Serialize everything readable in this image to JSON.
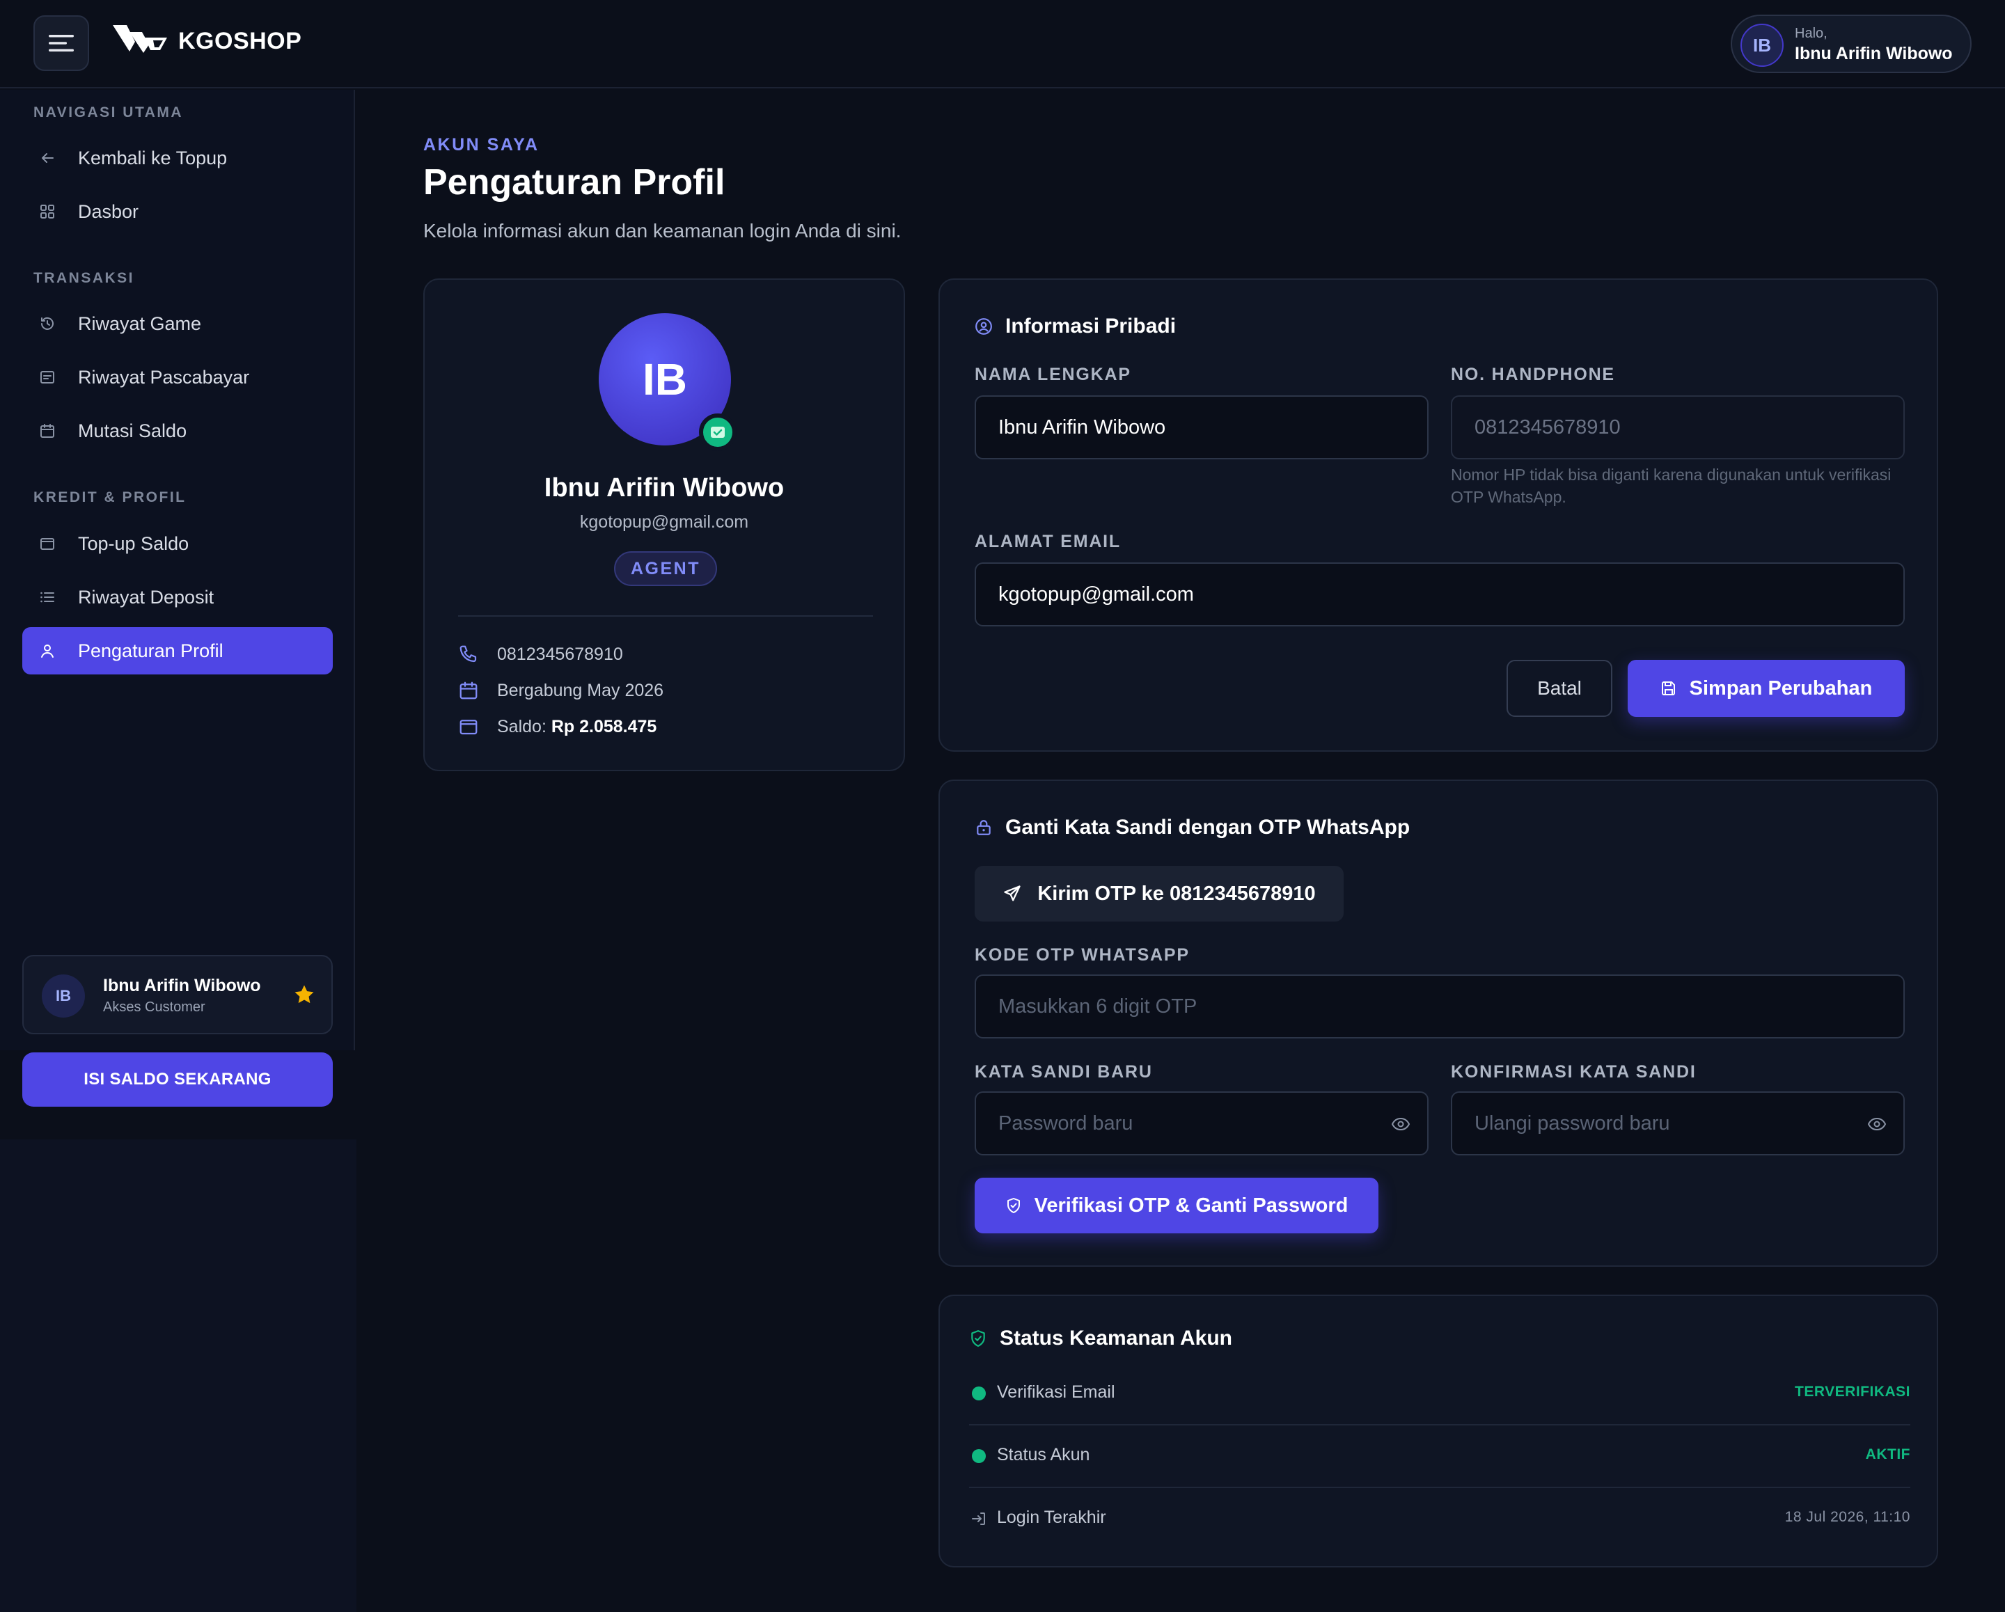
{
  "app": {
    "brand": "KGOSHOP"
  },
  "header": {
    "greeting": "Halo,",
    "user_name": "Ibnu Arifin Wibowo",
    "avatar_initials": "IB"
  },
  "sidebar": {
    "sections": [
      {
        "title": "NAVIGASI UTAMA",
        "items": [
          {
            "label": "Kembali ke Topup",
            "icon": "arrow-left-icon"
          },
          {
            "label": "Dasbor",
            "icon": "grid-icon"
          }
        ]
      },
      {
        "title": "TRANSAKSI",
        "items": [
          {
            "label": "Riwayat Game",
            "icon": "history-icon"
          },
          {
            "label": "Riwayat Pascabayar",
            "icon": "receipt-icon"
          },
          {
            "label": "Mutasi Saldo",
            "icon": "calendar-icon"
          }
        ]
      },
      {
        "title": "KREDIT & PROFIL",
        "items": [
          {
            "label": "Top-up Saldo",
            "icon": "wallet-icon"
          },
          {
            "label": "Riwayat Deposit",
            "icon": "list-icon"
          },
          {
            "label": "Pengaturan Profil",
            "icon": "user-icon",
            "active": true
          }
        ]
      }
    ],
    "user_card": {
      "initials": "IB",
      "name": "Ibnu Arifin Wibowo",
      "role": "Akses Customer"
    },
    "cta": "ISI SALDO SEKARANG"
  },
  "page": {
    "breadcrumb": "AKUN SAYA",
    "title": "Pengaturan Profil",
    "subtitle": "Kelola informasi akun dan keamanan login Anda di sini."
  },
  "profile": {
    "initials": "IB",
    "name": "Ibnu Arifin Wibowo",
    "email": "kgotopup@gmail.com",
    "role_badge": "AGENT",
    "phone": "0812345678910",
    "joined": "Bergabung May 2026",
    "balance_label": "Saldo:",
    "balance_value": "Rp 2.058.475"
  },
  "personal_info": {
    "title": "Informasi Pribadi",
    "name_label": "NAMA LENGKAP",
    "name_value": "Ibnu Arifin Wibowo",
    "phone_label": "NO. HANDPHONE",
    "phone_value": "0812345678910",
    "phone_hint": "Nomor HP tidak bisa diganti karena digunakan untuk verifikasi OTP WhatsApp.",
    "email_label": "ALAMAT EMAIL",
    "email_value": "kgotopup@gmail.com",
    "cancel": "Batal",
    "save": "Simpan Perubahan"
  },
  "password": {
    "title": "Ganti Kata Sandi dengan OTP WhatsApp",
    "send_otp": "Kirim OTP ke 0812345678910",
    "otp_label": "KODE OTP WHATSAPP",
    "otp_placeholder": "Masukkan 6 digit OTP",
    "new_label": "KATA SANDI BARU",
    "new_placeholder": "Password baru",
    "confirm_label": "KONFIRMASI KATA SANDI",
    "confirm_placeholder": "Ulangi password baru",
    "submit": "Verifikasi OTP & Ganti Password"
  },
  "security": {
    "title": "Status Keamanan Akun",
    "rows": [
      {
        "label": "Verifikasi Email",
        "value": "TERVERIFIKASI"
      },
      {
        "label": "Status Akun",
        "value": "AKTIF"
      },
      {
        "label": "Login Terakhir",
        "value": "18 Jul 2026, 11:10"
      }
    ]
  },
  "colors": {
    "accent": "#4f46e5",
    "success": "#10b981",
    "background": "#0b0f1a",
    "card": "#0f1524"
  }
}
